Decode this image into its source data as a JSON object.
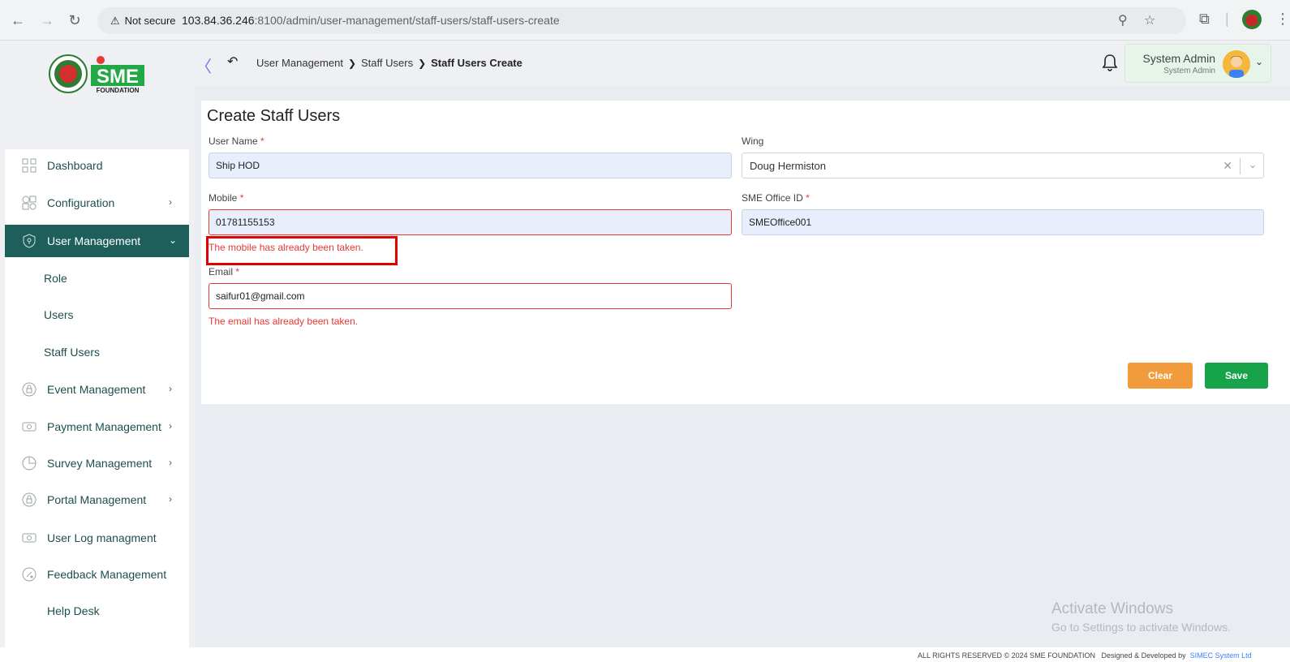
{
  "browser": {
    "not_secure": "Not secure",
    "url_host": "103.84.36.246",
    "url_rest": ":8100/admin/user-management/staff-users/staff-users-create"
  },
  "logo": {
    "line1": "SME",
    "line2": "FOUNDATION"
  },
  "sidebar": {
    "items": [
      {
        "label": "Dashboard",
        "icon": "grid-icon"
      },
      {
        "label": "Configuration",
        "icon": "shapes-icon"
      },
      {
        "label": "User Management",
        "icon": "shield-icon"
      },
      {
        "label": "Event Management",
        "icon": "lock-icon"
      },
      {
        "label": "Payment Management",
        "icon": "cash-icon"
      },
      {
        "label": "Survey Management",
        "icon": "pie-icon"
      },
      {
        "label": "Portal Management",
        "icon": "lock-icon"
      },
      {
        "label": "User Log managment",
        "icon": "cash-icon"
      },
      {
        "label": "Feedback Management",
        "icon": "feedback-icon"
      },
      {
        "label": "Help Desk",
        "icon": ""
      }
    ],
    "sub_items": [
      "Role",
      "Users",
      "Staff Users"
    ]
  },
  "header": {
    "breadcrumb": [
      "User Management",
      "Staff Users",
      "Staff Users Create"
    ],
    "user_name": "System Admin",
    "user_role": "System Admin"
  },
  "form": {
    "title": "Create Staff Users",
    "user_name_label": "User Name",
    "user_name_value": "Ship HOD",
    "wing_label": "Wing",
    "wing_value": "Doug Hermiston",
    "mobile_label": "Mobile",
    "mobile_value": "01781155153",
    "mobile_error": "The mobile has already been taken.",
    "office_label": "SME Office ID",
    "office_value": "SMEOffice001",
    "email_label": "Email",
    "email_value": "saifur01@gmail.com",
    "email_error": "The email has already been taken.",
    "required_mark": "*",
    "clear_label": "Clear",
    "save_label": "Save"
  },
  "watermark": {
    "line1": "Activate Windows",
    "line2": "Go to Settings to activate Windows."
  },
  "footer": {
    "copyright": "ALL RIGHTS RESERVED © 2024 SME FOUNDATION",
    "designed": "Designed & Developed by",
    "company": "SIMEC System Ltd"
  },
  "colors": {
    "primary": "#1f5f5b",
    "error": "#e53935",
    "clear_button": "#f29b3c",
    "save_button": "#16a34a"
  }
}
